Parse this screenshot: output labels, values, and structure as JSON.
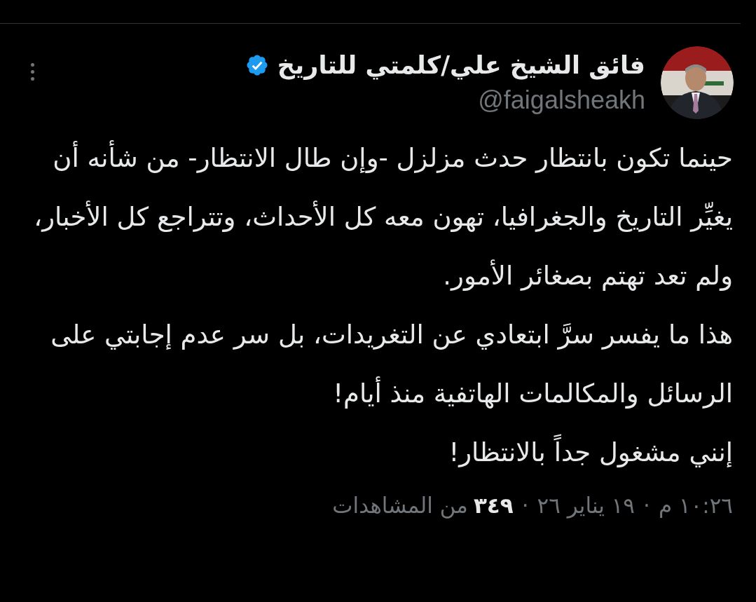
{
  "author": {
    "name": "فائق الشيخ علي/كلمتي للتاريخ",
    "verified": true,
    "handle": "@faigalsheakh"
  },
  "body": [
    "حينما تكون بانتظار حدث مزلزل -وإن طال الانتظار- من شأنه أن يغيِّر التاريخ والجغرافيا، تهون معه كل الأحداث، وتتراجع كل الأخبار، ولم تعد تهتم بصغائر الأمور.",
    "هذا ما يفسر سرَّ ابتعادي عن التغريدات، بل سر عدم إجابتي على الرسائل والمكالمات الهاتفية منذ أيام!",
    "إنني مشغول جداً بالانتظار!"
  ],
  "meta": {
    "time": "١٠:٢٦ م",
    "separator_1": "·",
    "date": "١٩ يناير ٢٦",
    "separator_2": "·",
    "views_count": "٣٤٩",
    "views_label": "من المشاهدات"
  }
}
